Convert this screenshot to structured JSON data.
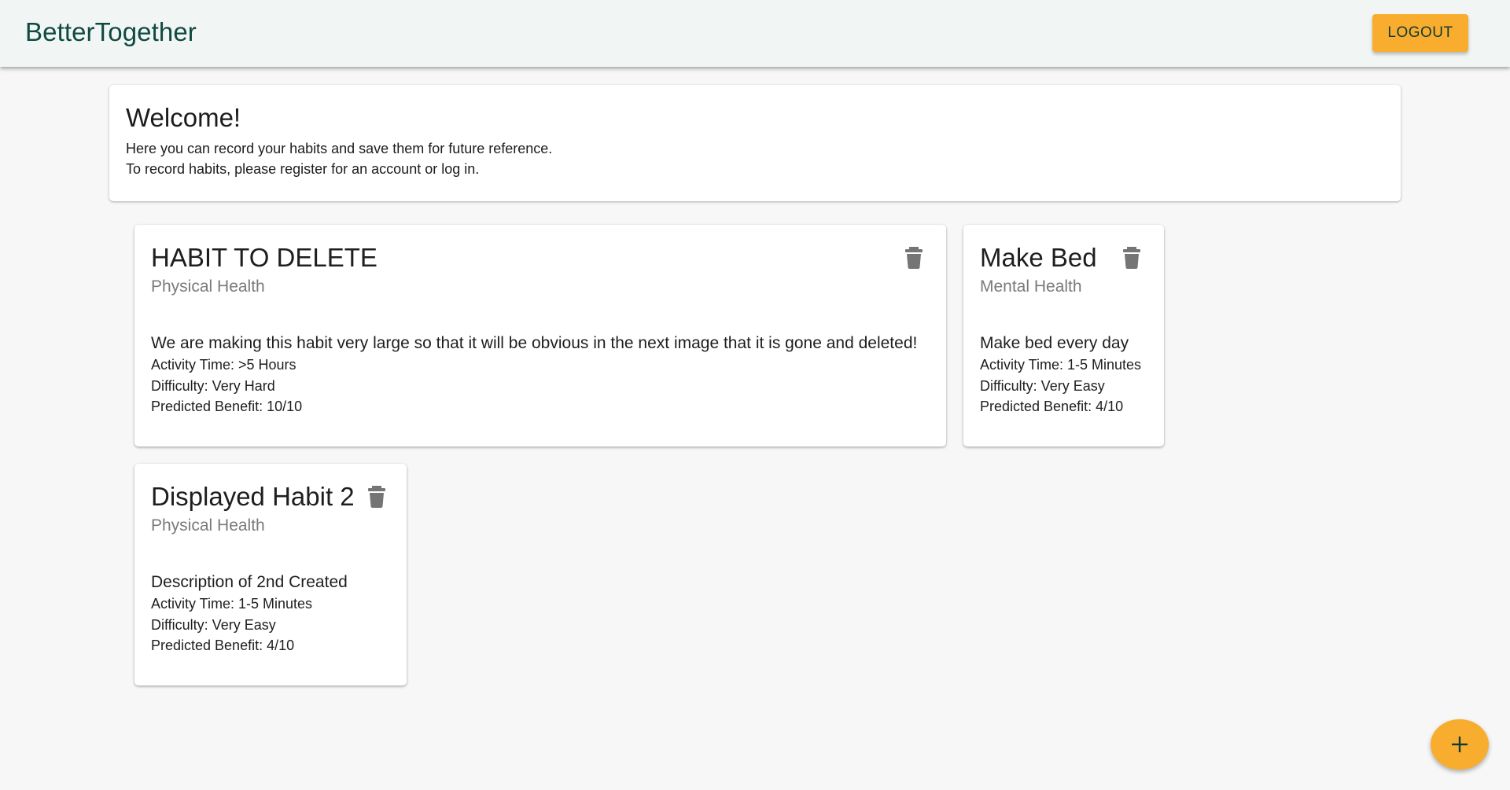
{
  "app": {
    "brand": "BetterTogether",
    "logout_label": "LOGOUT"
  },
  "welcome": {
    "title": "Welcome!",
    "line1": "Here you can record your habits and save them for future reference.",
    "line2": "To record habits, please register for an account or log in."
  },
  "habits": [
    {
      "title": "HABIT TO DELETE",
      "category": "Physical Health",
      "description": "We are making this habit very large so that it will be obvious in the next image that it is gone and deleted!",
      "activity_time": "Activity Time: >5 Hours",
      "difficulty": "Difficulty: Very Hard",
      "benefit": "Predicted Benefit: 10/10"
    },
    {
      "title": "Make Bed",
      "category": "Mental Health",
      "description": "Make bed every day",
      "activity_time": "Activity Time: 1-5 Minutes",
      "difficulty": "Difficulty: Very Easy",
      "benefit": "Predicted Benefit: 4/10"
    },
    {
      "title": "Displayed Habit 2",
      "category": "Physical Health",
      "description": "Description of 2nd Created",
      "activity_time": "Activity Time: 1-5 Minutes",
      "difficulty": "Difficulty: Very Easy",
      "benefit": "Predicted Benefit: 4/10"
    }
  ],
  "icons": {
    "delete": "trash-icon",
    "add": "plus-icon"
  },
  "colors": {
    "accent": "#f9ad2f",
    "brand": "#0f4a40",
    "appbar": "#f1f5f4",
    "background": "#f7f7f7",
    "icon": "#757575"
  }
}
